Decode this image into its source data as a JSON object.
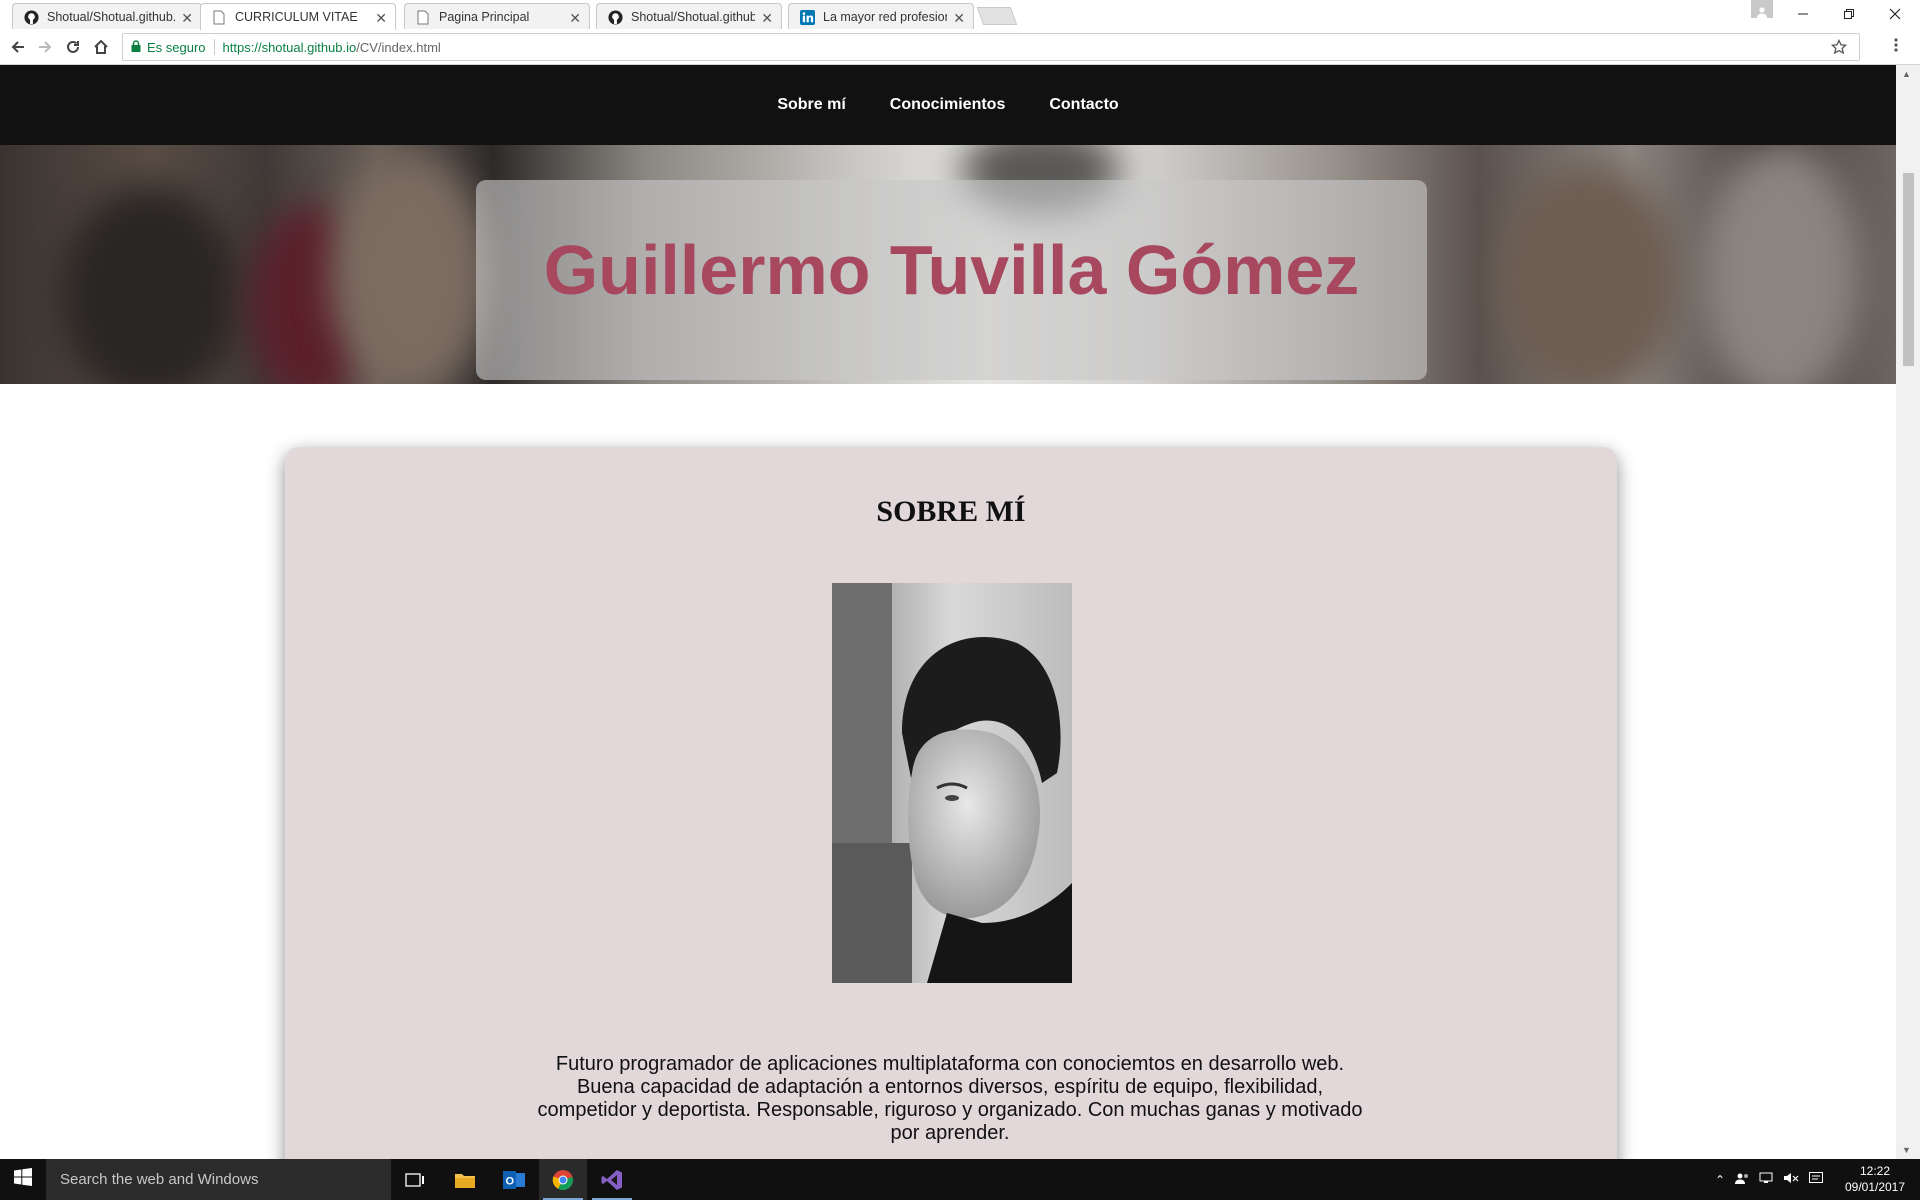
{
  "browser": {
    "tabs": [
      {
        "label": "Shotual/Shotual.github.io",
        "icon": "github-icon",
        "active": false
      },
      {
        "label": "CURRICULUM VITAE",
        "icon": "document-icon",
        "active": true
      },
      {
        "label": "Pagina Principal",
        "icon": "document-icon",
        "active": false
      },
      {
        "label": "Shotual/Shotual.github.io",
        "icon": "github-icon",
        "active": false
      },
      {
        "label": "La mayor red profesional",
        "icon": "linkedin-icon",
        "active": false
      }
    ],
    "security_label": "Es seguro",
    "url_host": "https://shotual.github.io",
    "url_path": "/CV/index.html"
  },
  "site": {
    "nav": [
      "Sobre mí",
      "Conocimientos",
      "Contacto"
    ],
    "hero_title": "Guillermo Tuvilla Gómez",
    "about_title": "SOBRE MÍ",
    "about_text": "Futuro programador de aplicaciones multiplataforma con conociemtos en desarrollo web. Buena capacidad de adaptación a entornos diversos, espíritu de equipo, flexibilidad, competidor y deportista. Responsable, riguroso y organizado. Con muchas ganas y motivado por aprender."
  },
  "taskbar": {
    "search_placeholder": "Search the web and Windows",
    "time": "12:22",
    "date": "09/01/2017"
  },
  "colors": {
    "hero_title": "#a8485f",
    "card_bg": "#e2d8da",
    "nav_bg": "#111111"
  }
}
